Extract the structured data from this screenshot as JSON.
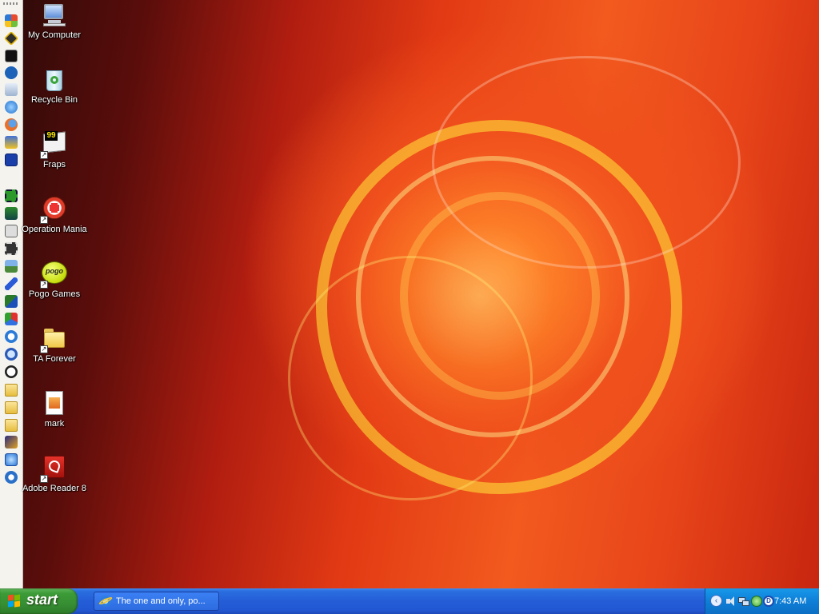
{
  "desktop": {
    "icons": [
      {
        "label": "My Computer",
        "icon": "computer-icon",
        "shortcut": false
      },
      {
        "label": "Recycle Bin",
        "icon": "recycle-bin-icon",
        "shortcut": false
      },
      {
        "label": "Fraps",
        "icon": "fraps-icon",
        "shortcut": true
      },
      {
        "label": "Operation Mania",
        "icon": "operation-mania-icon",
        "shortcut": true
      },
      {
        "label": "Pogo Games",
        "icon": "pogo-icon",
        "shortcut": true
      },
      {
        "label": "TA Forever",
        "icon": "folder-icon",
        "shortcut": true
      },
      {
        "label": "mark",
        "icon": "image-file-icon",
        "shortcut": false
      },
      {
        "label": "Adobe Reader 8",
        "icon": "adobe-reader-icon",
        "shortcut": true
      }
    ],
    "fraps_icon_text": "99",
    "pogo_icon_text": "pogo"
  },
  "quicklaunch": {
    "icons": [
      "windows-update-icon",
      "game-icon",
      "fraps-icon",
      "hp-icon",
      "music-icon",
      "ie-icon",
      "firefox-icon",
      "paint-icon",
      "app-icon",
      "film-icon",
      "photo-icon",
      "calculator-icon",
      "film-strip-icon",
      "landscape-icon",
      "pen-icon",
      "image-icon",
      "shapes-icon",
      "search-icon",
      "help-icon",
      "panda-icon",
      "folder-icon",
      "folder-icon",
      "folder-icon",
      "star-icon",
      "ie-alt-icon",
      "media-player-icon"
    ]
  },
  "taskbar": {
    "start_label": "start",
    "tasks": [
      {
        "label": "The one and only, po...",
        "icon": "ie-icon"
      }
    ],
    "tray_icons": [
      "volume-icon",
      "network-icon",
      "security-icon",
      "status-icon"
    ],
    "clock": "7:43 AM"
  },
  "colors": {
    "taskbar": "#245dd7",
    "start": "#3c9b37",
    "tray": "#0e7fd7"
  }
}
